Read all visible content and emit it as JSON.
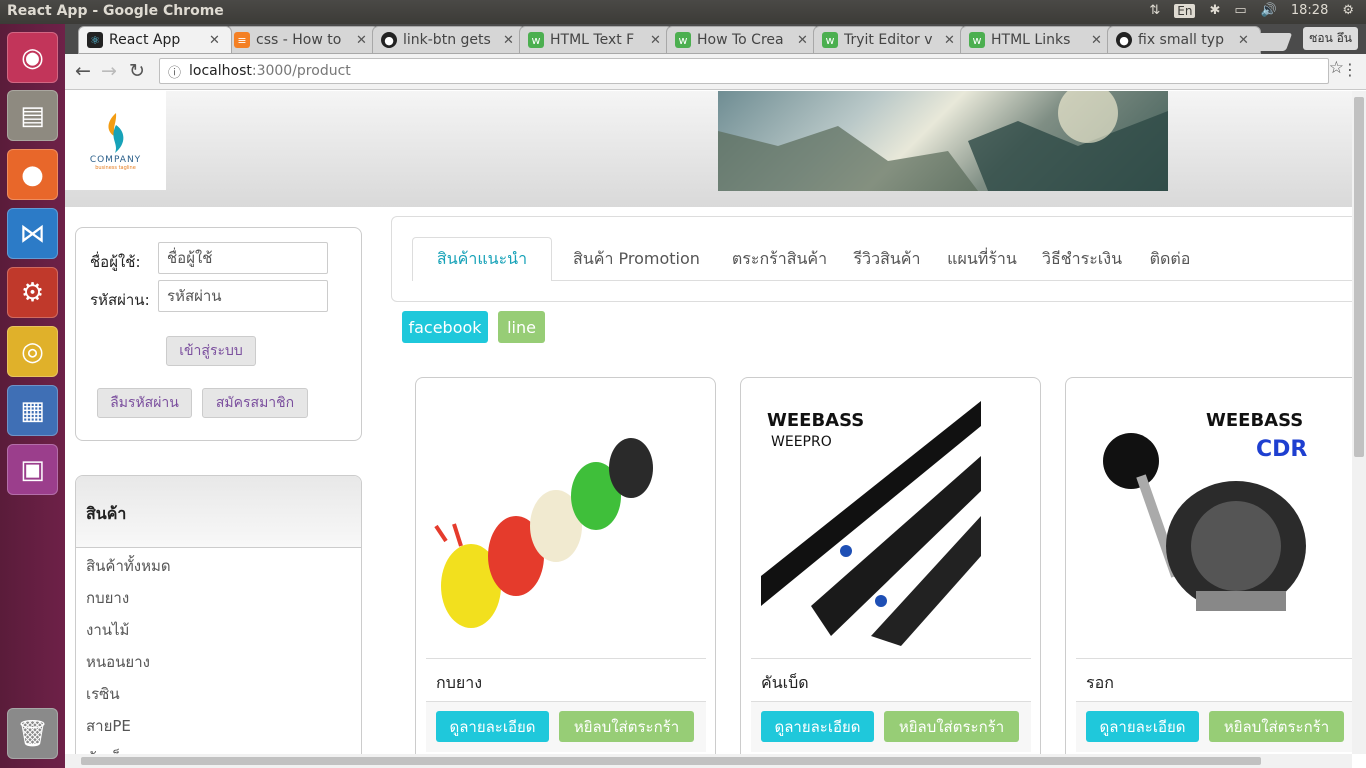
{
  "os": {
    "window_title": "React App - Google Chrome",
    "keyboard": "En",
    "clock": "18:28"
  },
  "tabs": [
    {
      "label": "React App",
      "icon": "react-icon",
      "color": "#61dafb"
    },
    {
      "label": "css - How to",
      "icon": "stackoverflow-icon",
      "color": "#f48024"
    },
    {
      "label": "link-btn gets",
      "icon": "github-icon",
      "color": "#222222"
    },
    {
      "label": "HTML Text F",
      "icon": "w3schools-icon",
      "color": "#4caf50"
    },
    {
      "label": "How To Crea",
      "icon": "w3schools-icon",
      "color": "#4caf50"
    },
    {
      "label": "Tryit Editor v",
      "icon": "w3schools-icon",
      "color": "#4caf50"
    },
    {
      "label": "HTML Links",
      "icon": "w3schools-icon",
      "color": "#4caf50"
    },
    {
      "label": "fix small typ",
      "icon": "github-icon",
      "color": "#222222"
    }
  ],
  "profile": "ซอน อึน",
  "address": {
    "host": "localhost",
    "path": ":3000/product"
  },
  "logo": {
    "name": "COMPANY",
    "tagline": "business tagline"
  },
  "login": {
    "user_label": "ชื่อผู้ใช้:",
    "user_placeholder": "ชื่อผู้ใช้",
    "pass_label": "รหัสผ่าน:",
    "pass_placeholder": "รหัสผ่าน",
    "login_btn": "เข้าสู่ระบบ",
    "forgot_btn": "ลืมรหัสผ่าน",
    "register_btn": "สมัครสมาชิก"
  },
  "categories": {
    "title": "สินค้า",
    "items": [
      "สินค้าทั้งหมด",
      "กบยาง",
      "งานไม้",
      "หนอนยาง",
      "เรซิน",
      "สายPE",
      "คันเบ็ด"
    ]
  },
  "nav_tabs": [
    "สินค้าแนะนำ",
    "สินค้า Promotion",
    "ตระกร้าสินค้า",
    "รีวิวสินค้า",
    "แผนที่ร้าน",
    "วิธีชำระเงิน",
    "ติดต่อ"
  ],
  "social": {
    "facebook": "facebook",
    "line": "line"
  },
  "products": [
    {
      "name": "กบยาง",
      "detail_btn": "ดูลายละเอียด",
      "cart_btn": "หยิลบใส่ตระกร้า"
    },
    {
      "name": "คันเบ็ด",
      "detail_btn": "ดูลายละเอียด",
      "cart_btn": "หยิลบใส่ตระกร้า",
      "brand": "WEEBASS",
      "model": "WEEPRO"
    },
    {
      "name": "รอก",
      "detail_btn": "ดูลายละเอียด",
      "cart_btn": "หยิลบใส่ตระกร้า",
      "brand": "WEEBASS",
      "model": "CDR"
    }
  ],
  "colors": {
    "teal": "#1fc8db",
    "green": "#97cd76",
    "launcher": "#6e2148"
  }
}
